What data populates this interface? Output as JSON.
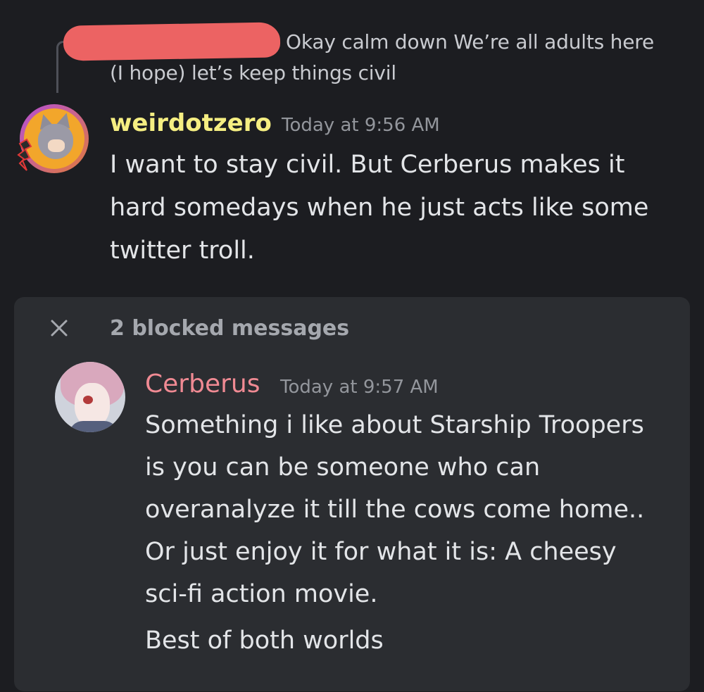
{
  "reply": {
    "text": "Okay calm down  We’re all adults here (I hope) let’s keep things civil"
  },
  "message1": {
    "username": "weirdotzero",
    "timestamp": "Today at 9:56 AM",
    "content": "I want to stay civil. But Cerberus makes it hard somedays when he just acts like some twitter troll.",
    "username_color": "#f5ee82"
  },
  "blocked": {
    "label": "2 blocked messages",
    "close_icon": "close-icon"
  },
  "message2": {
    "username": "Cerberus",
    "timestamp": "Today at 9:57 AM",
    "content": "Something i like about Starship Troopers is you can be someone who can overanalyze it till the cows come home.. Or just enjoy it for what it is: A cheesy sci-fi action movie.",
    "username_color": "#f08a93"
  },
  "message3": {
    "content": "Best of both worlds"
  }
}
